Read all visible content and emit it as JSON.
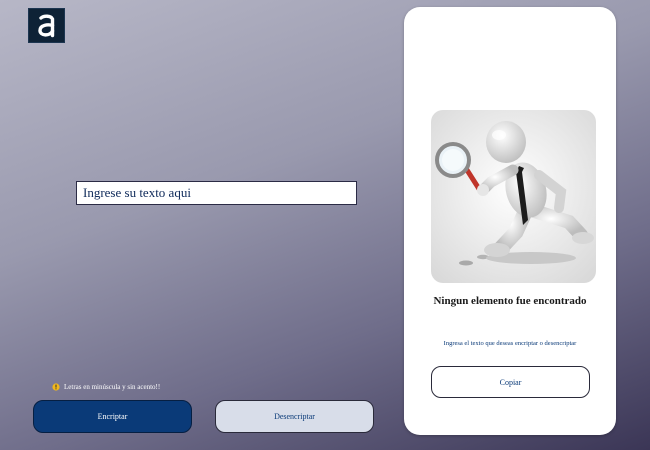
{
  "header": {
    "logo_icon": "alura-logo-icon"
  },
  "input": {
    "placeholder": "Ingrese su texto aqui",
    "value": ""
  },
  "hint": {
    "icon": "warning-icon",
    "text": "Letras en minúscula y sin acento!!"
  },
  "buttons": {
    "encrypt_label": "Encriptar",
    "decrypt_label": "Desencriptar"
  },
  "result_panel": {
    "illustration_icon": "search-figure-illustration",
    "title": "Ningun elemento fue encontrado",
    "description": "Ingresa el texto que deseas encriptar o desencriptar",
    "copy_label": "Copiar"
  },
  "colors": {
    "primary": "#0a3a78",
    "secondary_button_bg": "#d8dde9",
    "panel_bg": "#ffffff",
    "logo_bg": "#0e2236"
  }
}
